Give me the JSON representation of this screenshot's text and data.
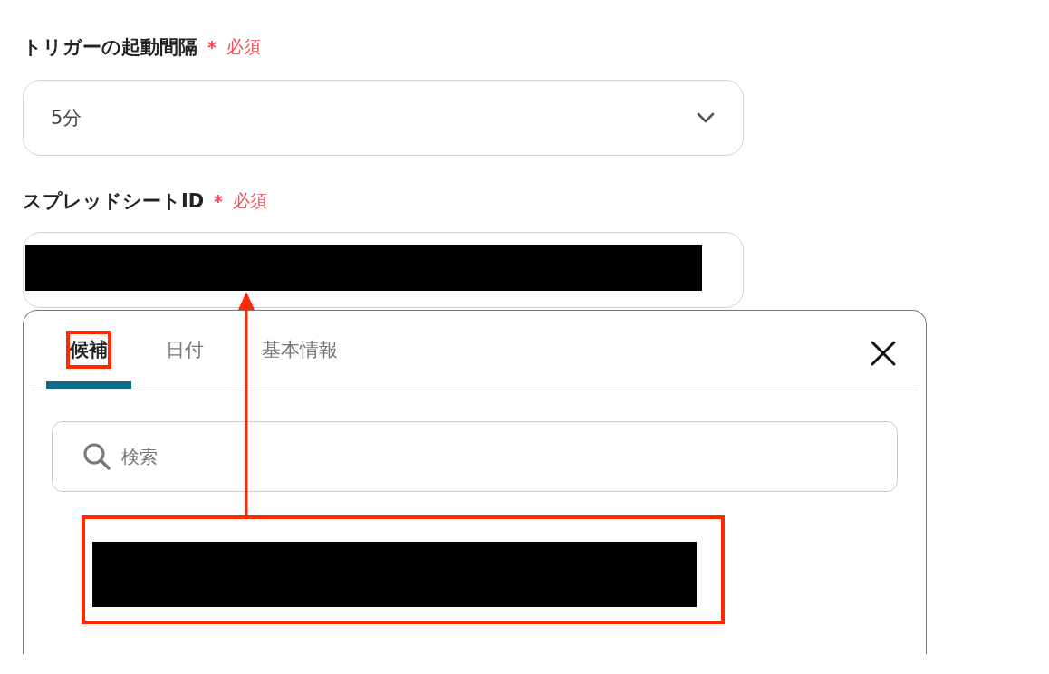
{
  "fields": [
    {
      "kind": "select",
      "label": "トリガーの起動間隔",
      "required_mark": "＊",
      "required_text": "必須",
      "value": "5分"
    },
    {
      "kind": "text",
      "label": "スプレッドシートID",
      "required_mark": "＊",
      "required_text": "必須",
      "redacted": true
    }
  ],
  "picker": {
    "tabs": [
      {
        "label": "候補",
        "selected": true,
        "highlighted": true
      },
      {
        "label": "日付",
        "selected": false,
        "highlighted": false
      },
      {
        "label": "基本情報",
        "selected": false,
        "highlighted": false
      }
    ],
    "search": {
      "placeholder": "検索"
    },
    "items": [
      {
        "redacted": true,
        "highlighted": true
      }
    ]
  },
  "annotations": [
    {
      "kind": "arrow"
    }
  ]
}
